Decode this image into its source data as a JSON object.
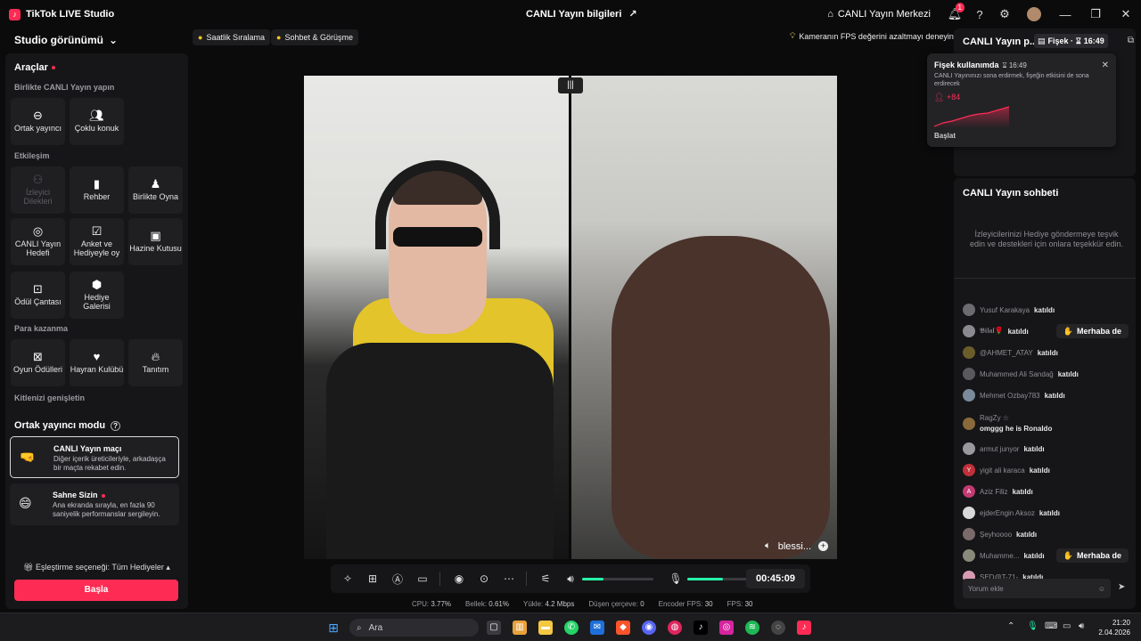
{
  "titlebar": {
    "app_name": "TikTok LIVE Studio",
    "center_title": "CANLI Yayın bilgileri",
    "hub_label": "CANLI Yayın Merkezi",
    "notification_count": "1",
    "minimize": "—",
    "maximize": "❐",
    "close": "✕"
  },
  "left": {
    "studio_view": "Studio görünümü",
    "tools_title": "Araçlar",
    "section_collab": "Birlikte CANLI Yayın yapın",
    "collab_tiles": [
      {
        "label": "Ortak yayıncı",
        "icon": "link-icon"
      },
      {
        "label": "Çoklu konuk",
        "icon": "users-icon"
      }
    ],
    "section_engage": "Etkileşim",
    "engage_tiles": [
      {
        "label": "İzleyici Dilekleri",
        "icon": "wishes-icon"
      },
      {
        "label": "Rehber",
        "icon": "guide-icon"
      },
      {
        "label": "Birlikte Oyna",
        "icon": "play-together-icon"
      },
      {
        "label": "CANLI Yayın Hedefi",
        "icon": "target-icon"
      },
      {
        "label": "Anket ve Hediyeyle oy",
        "icon": "poll-icon"
      },
      {
        "label": "Hazine Kutusu",
        "icon": "treasure-icon"
      },
      {
        "label": "Ödül Çantası",
        "icon": "reward-bag-icon"
      },
      {
        "label": "Hediye Galerisi",
        "icon": "gift-gallery-icon"
      }
    ],
    "section_monetize": "Para kazanma",
    "monetize_tiles": [
      {
        "label": "Oyun Ödülleri",
        "icon": "game-rewards-icon"
      },
      {
        "label": "Hayran Kulübü",
        "icon": "fan-club-icon"
      },
      {
        "label": "Tanıtım",
        "icon": "promote-icon"
      }
    ],
    "section_expand": "Kitlenizi genişletin",
    "cohost_title": "Ortak yayıncı modu",
    "modes": [
      {
        "title": "CANLI Yayın maçı",
        "desc": "Diğer içerik üreticileriyle, arkadaşça bir maçta rekabet edin."
      },
      {
        "title": "Sahne Sizin",
        "desc": "Ana ekranda sırayla, en fazla 90 saniyelik performanslar sergileyin."
      }
    ],
    "match_option": "Eşleştirme seçeneği: Tüm Hediyeler",
    "start_button": "Başla"
  },
  "center": {
    "pill_ranking": "Saatlik Sıralama",
    "pill_chat": "Sohbet & Görüşme",
    "fps_tip": "Kameranın FPS değerini azaltmayı deneyin",
    "guest_name": "blessi...",
    "timer": "00:45:09",
    "volume_level": 0.3,
    "mic_level": 0.5,
    "stats": [
      {
        "label": "CPU:",
        "value": "3.77%"
      },
      {
        "label": "Bellek:",
        "value": "0.61%"
      },
      {
        "label": "Yükle:",
        "value": "4.2 Mbps"
      },
      {
        "label": "Düşen çerçeve:",
        "value": "0"
      },
      {
        "label": "Encoder FPS:",
        "value": "30"
      },
      {
        "label": "FPS:",
        "value": "30"
      }
    ]
  },
  "right": {
    "title": "CANLI Yayın p...",
    "fisek_label": "Fişek ·",
    "fisek_time": "16:49",
    "popup": {
      "title": "Fişek kullanımda",
      "time": "16:49",
      "desc": "CANLI Yayınınızı sona erdirmek, fişeğin etkisini de sona erdirecek",
      "gain": "+84",
      "start": "Başlat"
    },
    "chat_title": "CANLI Yayın sohbeti",
    "chat_hint": "İzleyicilerinizi Hediye göndermeye teşvik edin ve destekleri için onlara teşekkür edin.",
    "joined": "katıldı",
    "wave_label": "Merhaba de",
    "messages": [
      {
        "name": "Yusuf Karakaya",
        "text": "katıldı",
        "color": "#6b6b70"
      },
      {
        "name": "𝕭𝖎𝖑𝖆𝖑🌹",
        "text": "katıldı",
        "color": "#8a8a90",
        "wave": true
      },
      {
        "name": "@AHMET_ATAY",
        "text": "katıldı",
        "color": "#6b5d2a"
      },
      {
        "name": "Muhammed Ali Sandağ",
        "text": "katıldı",
        "color": "#5a5a5e"
      },
      {
        "name": "Mehmet Ozbay783",
        "text": "katıldı",
        "color": "#7a8a9a"
      },
      {
        "name": "RagZy ☆",
        "text": "omggg he is Ronaldo",
        "color": "#8a6a3a",
        "two_line": true
      },
      {
        "name": "armut junyor",
        "text": "katıldı",
        "color": "#9a9a9e"
      },
      {
        "name": "yigit ali karaca",
        "text": "katıldı",
        "color": "#c0303a",
        "initial": "Y"
      },
      {
        "name": "Aziz Filiz",
        "text": "katıldı",
        "color": "#c23a72",
        "initial": "A"
      },
      {
        "name": "ejderEngin Aksoz",
        "text": "katıldı",
        "color": "#d8d8da"
      },
      {
        "name": "Şeyhoooo",
        "text": "katıldı",
        "color": "#7a6a6a"
      },
      {
        "name": "Muhamme...",
        "text": "katıldı",
        "color": "#8a8a7a",
        "wave": true
      },
      {
        "name": "SED@T-71-",
        "text": "katıldı",
        "color": "#d89ab0"
      }
    ],
    "comment_placeholder": "Yorum ekle"
  },
  "taskbar": {
    "search": "Ara",
    "time": "21:20",
    "date": "2.04.2026"
  },
  "colors": {
    "accent": "#fe2c55",
    "panel": "#161618",
    "meter": "#25f4a8"
  }
}
